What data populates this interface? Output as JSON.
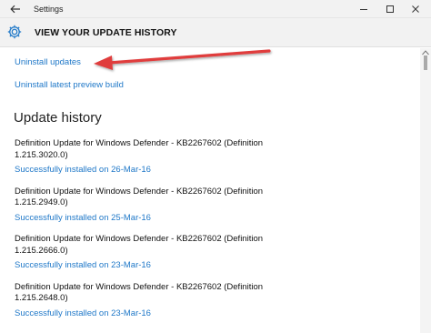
{
  "window": {
    "title": "Settings",
    "back_icon": "back-arrow-icon",
    "controls": [
      "minimize-icon",
      "maximize-icon",
      "close-icon"
    ]
  },
  "header": {
    "icon": "gear-icon",
    "title": "VIEW YOUR UPDATE HISTORY"
  },
  "links": {
    "uninstall_updates": "Uninstall updates",
    "uninstall_preview": "Uninstall latest preview build"
  },
  "history": {
    "heading": "Update history",
    "entries": [
      {
        "name_line1": "Definition Update for Windows Defender - KB2267602 (Definition",
        "name_line2": "1.215.3020.0)",
        "status": "Successfully installed on 26-Mar-16"
      },
      {
        "name_line1": "Definition Update for Windows Defender - KB2267602 (Definition",
        "name_line2": "1.215.2949.0)",
        "status": "Successfully installed on 25-Mar-16"
      },
      {
        "name_line1": "Definition Update for Windows Defender - KB2267602 (Definition",
        "name_line2": "1.215.2666.0)",
        "status": "Successfully installed on 23-Mar-16"
      },
      {
        "name_line1": "Definition Update for Windows Defender - KB2267602 (Definition",
        "name_line2": "1.215.2648.0)",
        "status": "Successfully installed on 23-Mar-16"
      }
    ]
  },
  "colors": {
    "link": "#1f78c8",
    "annotation_arrow": "#e03c3c",
    "chrome_bg": "#f2f2f2"
  }
}
